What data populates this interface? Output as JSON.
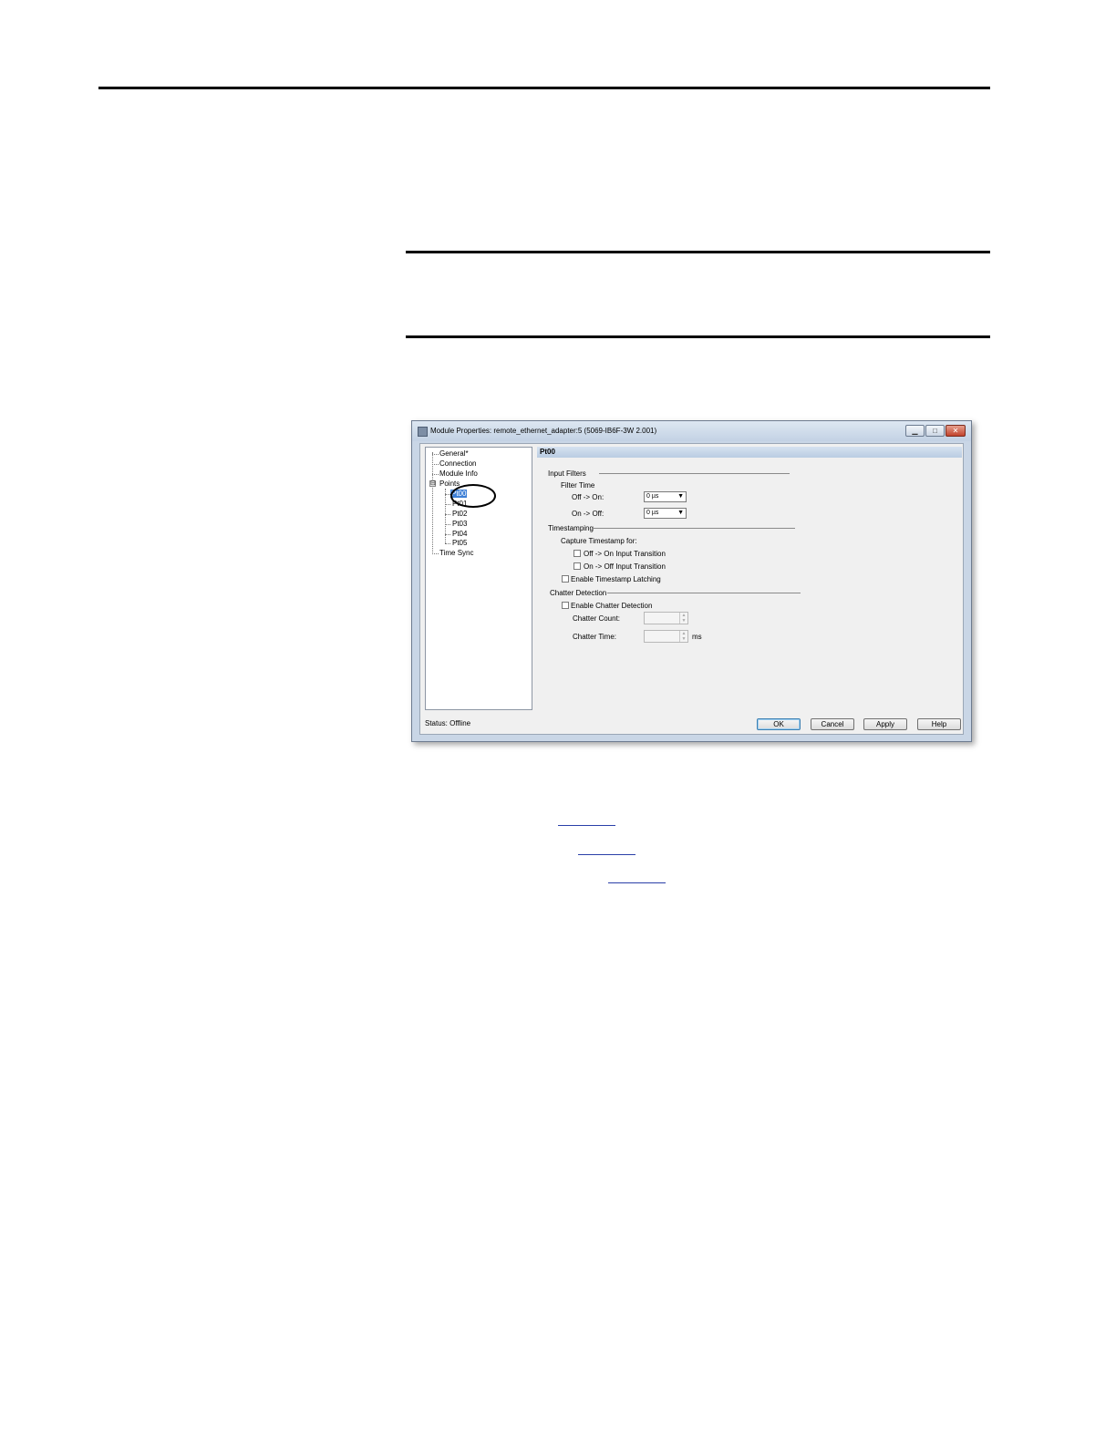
{
  "dialog": {
    "title": "Module Properties: remote_ethernet_adapter:5 (5069-IB6F-3W 2.001)",
    "tree": {
      "general": "General*",
      "connection": "Connection",
      "module_info": "Module Info",
      "points": "Points",
      "expander": "⊟",
      "pt00": "Pt00",
      "pt01": "Pt01",
      "pt02": "Pt02",
      "pt03": "Pt03",
      "pt04": "Pt04",
      "pt05": "Pt05",
      "time_sync": "Time Sync"
    },
    "panel": {
      "header": "Pt00",
      "input_filters": "Input Filters",
      "filter_time": "Filter Time",
      "off_on_label": "Off -> On:",
      "off_on_value": "0 µs",
      "on_off_label": "On -> Off:",
      "on_off_value": "0 µs",
      "timestamping": "Timestamping",
      "capture_label": "Capture Timestamp for:",
      "cap_off_on": "Off -> On Input Transition",
      "cap_on_off": "On -> Off Input Transition",
      "latching": "Enable Timestamp Latching",
      "chatter_detection": "Chatter Detection",
      "enable_chatter": "Enable Chatter Detection",
      "chatter_count": "Chatter Count:",
      "chatter_time": "Chatter Time:",
      "ms": "ms"
    },
    "status": "Status:  Offline",
    "buttons": {
      "ok": "OK",
      "cancel": "Cancel",
      "apply": "Apply",
      "help": "Help"
    },
    "window_buttons": {
      "minimize": "▁",
      "maximize": "□",
      "close": "✕"
    }
  }
}
